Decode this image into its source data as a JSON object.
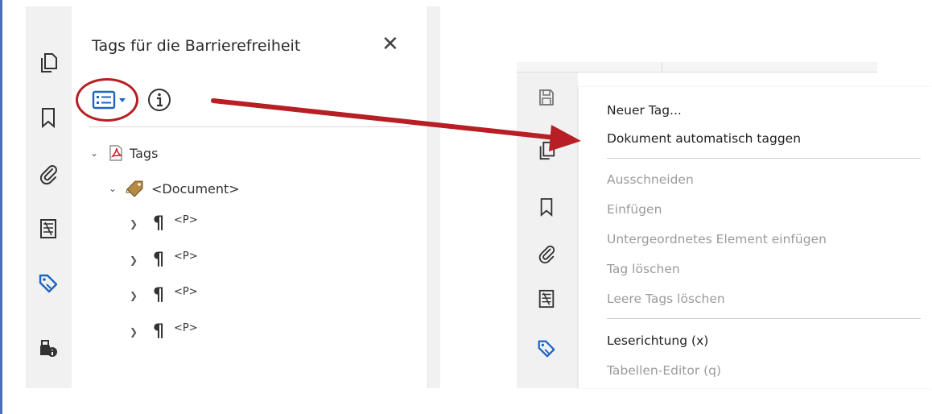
{
  "left_panel": {
    "title": "Tags für die Barrierefreiheit",
    "close_glyph": "✕",
    "options_icon": "options-list-icon",
    "info_icon": "info-icon",
    "tree": [
      {
        "label": "Tags",
        "depth": 0,
        "expanded": true,
        "icon": "pdf-tags-icon"
      },
      {
        "label": "<Document>",
        "depth": 1,
        "expanded": true,
        "icon": "tag-icon"
      },
      {
        "label": "<P>",
        "depth": 2,
        "expanded": false,
        "icon": "pilcrow-icon"
      },
      {
        "label": "<P>",
        "depth": 2,
        "expanded": false,
        "icon": "pilcrow-icon"
      },
      {
        "label": "<P>",
        "depth": 2,
        "expanded": false,
        "icon": "pilcrow-icon"
      },
      {
        "label": "<P>",
        "depth": 2,
        "expanded": false,
        "icon": "pilcrow-icon"
      }
    ],
    "rail_icons": [
      "pages-icon",
      "bookmark-icon",
      "attachment-icon",
      "content-icon",
      "accessibility-tags-icon",
      "security-icon"
    ]
  },
  "context_menu": {
    "items": [
      {
        "label": "Neuer Tag...",
        "enabled": true
      },
      {
        "label": "Dokument automatisch taggen",
        "enabled": true
      },
      {
        "label": "Ausschneiden",
        "enabled": false
      },
      {
        "label": "Einfügen",
        "enabled": false
      },
      {
        "label": "Untergeordnetes Element einfügen",
        "enabled": false
      },
      {
        "label": "Tag löschen",
        "enabled": false
      },
      {
        "label": "Leere Tags löschen",
        "enabled": false
      },
      {
        "label": "Leserichtung (x)",
        "enabled": true
      },
      {
        "label": "Tabellen-Editor (q)",
        "enabled": false
      }
    ]
  },
  "colors": {
    "highlight_red": "#b81f25",
    "accent_blue": "#1d64c2",
    "border_blue": "#4a6fb6"
  }
}
